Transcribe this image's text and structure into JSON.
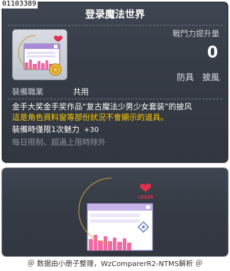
{
  "item": {
    "code": "01103389",
    "name": "登录魔法世界",
    "attack_label": "戰鬥力提升量",
    "attack_value": "0",
    "tags": [
      "防具",
      "披風"
    ],
    "job_label": "裝備職業",
    "job_value": "共用",
    "description": {
      "line1": "金手大奖金手奖作品“复古魔法少男少女套装”的披风",
      "line2": "這是角色資料窗等部份狀況不會顯示的道具。",
      "line3": "裝備時僅限1次魅力",
      "line3_bonus": "+30",
      "line4": "每日限制、超過上限時除外"
    }
  },
  "preview": {
    "badge_text": "LOGIN"
  },
  "footer": {
    "text": "＠ 数据由小册子整理，WzComparerR2-NTMS解析 ＠"
  },
  "colors": {
    "panel_bg": "#363c46",
    "title": "#ffffff",
    "warning_text": "#ffcc00",
    "muted_text": "#8d939c",
    "moon": "#f2c14a",
    "heart": "#e0304a"
  },
  "icons": {
    "item_icon": "crescent-moon-login-cape-icon",
    "preview_icon": "crescent-moon-login-cape-preview"
  }
}
